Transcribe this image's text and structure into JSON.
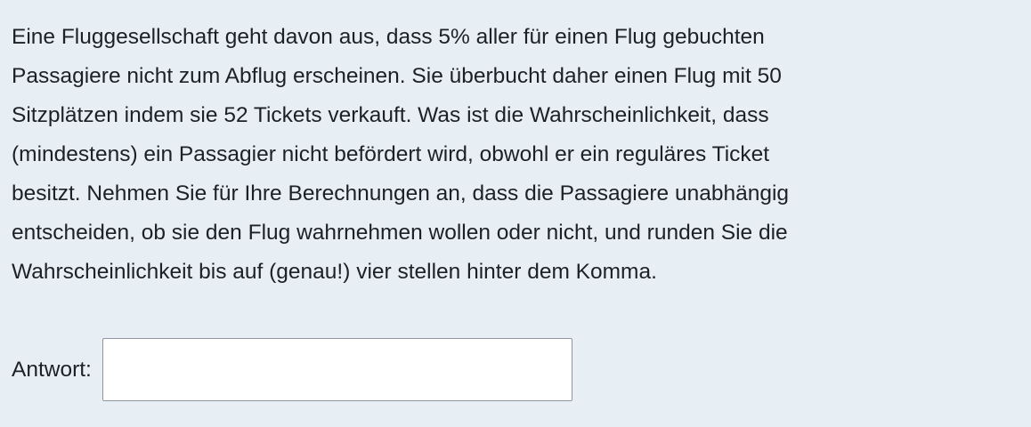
{
  "question": {
    "lines": [
      "Eine Fluggesellschaft geht davon aus, dass 5% aller für einen Flug gebuchten",
      "Passagiere nicht zum Abflug erscheinen. Sie überbucht daher einen Flug mit 50",
      "Sitzplätzen indem sie 52 Tickets verkauft. Was ist die Wahrscheinlichkeit, dass",
      "(mindestens) ein Passagier nicht befördert wird, obwohl er ein reguläres Ticket",
      "besitzt. Nehmen Sie für Ihre Berechnungen an, dass die Passagiere unabhängig",
      "entscheiden, ob sie den Flug wahrnehmen wollen oder nicht, und runden Sie die",
      "Wahrscheinlichkeit bis auf (genau!) vier stellen hinter dem Komma."
    ]
  },
  "answer": {
    "label": "Antwort:",
    "value": ""
  },
  "colors": {
    "background": "#e7eff5",
    "text": "#1d2125",
    "input_border": "#8f959e",
    "input_background": "#ffffff"
  }
}
